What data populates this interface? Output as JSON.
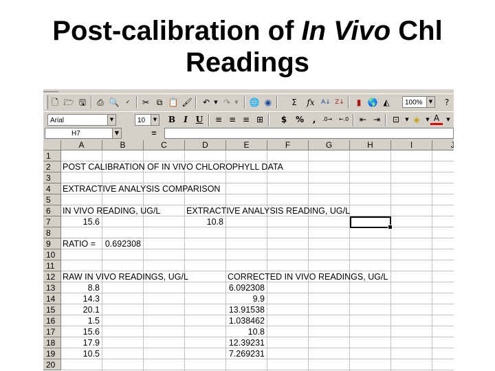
{
  "slide": {
    "title_line1_prefix": "Post-calibration of ",
    "title_line1_italic": "In Vivo",
    "title_line1_suffix": " Chl",
    "title_line2": "Readings"
  },
  "toolbar": {
    "zoom": "100%",
    "font_name": "Arial",
    "font_size": "10",
    "bold_label": "B",
    "italic_label": "I",
    "underline_label": "U",
    "autosum_label": "Σ",
    "function_label": "fx",
    "currency_label": "$",
    "percent_label": "%",
    "comma_label": ","
  },
  "formula_bar": {
    "name_box": "H7",
    "equals": "="
  },
  "columns": [
    "A",
    "B",
    "C",
    "D",
    "E",
    "F",
    "G",
    "H",
    "I",
    "J"
  ],
  "rows": [
    "1",
    "2",
    "3",
    "4",
    "5",
    "6",
    "7",
    "8",
    "9",
    "10",
    "11",
    "12",
    "13",
    "14",
    "15",
    "16",
    "17",
    "18",
    "19",
    "20"
  ],
  "sheet": {
    "title": "POST CALIBRATION OF IN VIVO CHLOROPHYLL DATA",
    "subtitle": "EXTRACTIVE ANALYSIS COMPARISON",
    "in_vivo_label": "IN VIVO READING, UG/L",
    "extractive_label": "EXTRACTIVE ANALYSIS READING, UG/L",
    "in_vivo_value": "15.6",
    "extractive_value": "10.8",
    "ratio_label": "RATIO =",
    "ratio_value": "0.692308",
    "raw_header": "RAW IN VIVO READINGS, UG/L",
    "corrected_header": "CORRECTED IN VIVO READINGS, UG/L",
    "raw": [
      "8.8",
      "14.3",
      "20.1",
      "1.5",
      "15.6",
      "17.9",
      "10.5"
    ],
    "corrected": [
      "6.092308",
      "9.9",
      "13.91538",
      "1.038462",
      "10.8",
      "12.39231",
      "7.269231"
    ]
  }
}
